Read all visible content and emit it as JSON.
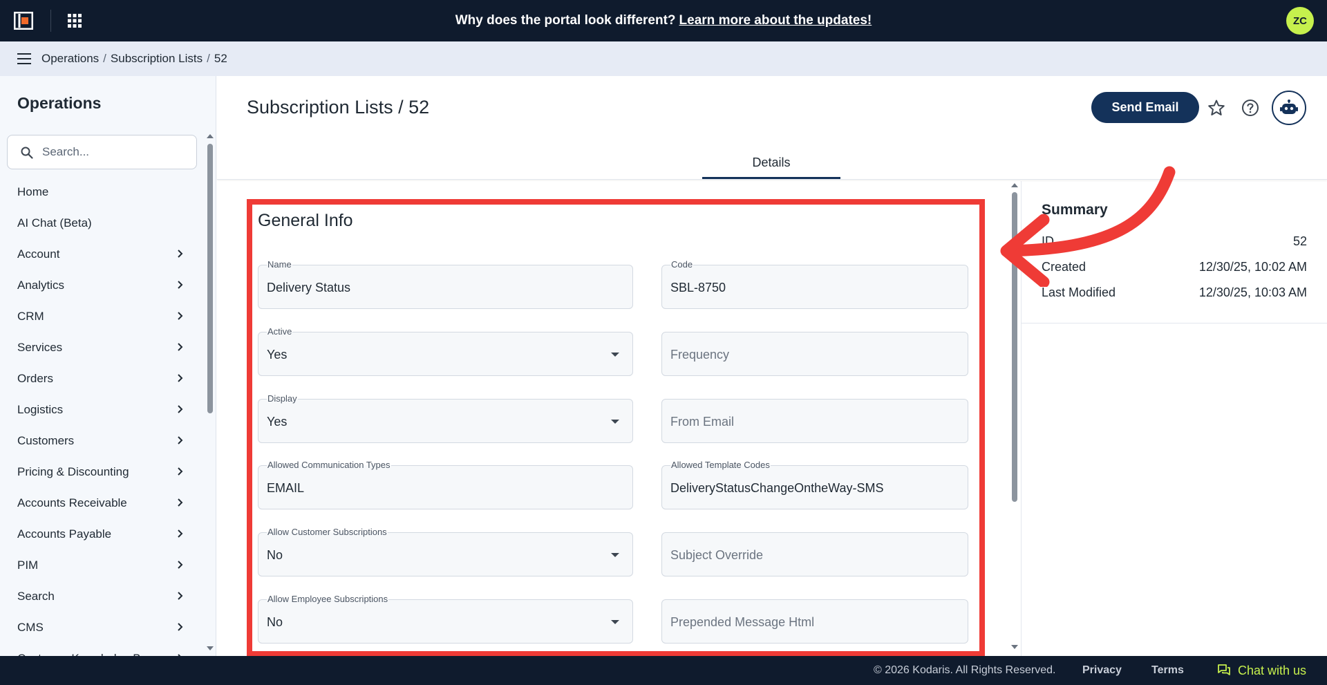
{
  "banner": {
    "question": "Why does the portal look different?",
    "link": "Learn more about the updates!"
  },
  "user": {
    "initials": "ZC"
  },
  "breadcrumb": {
    "items": [
      "Operations",
      "Subscription Lists",
      "52"
    ]
  },
  "sidebar": {
    "title": "Operations",
    "search_placeholder": "Search...",
    "items": [
      {
        "label": "Home",
        "has_children": false
      },
      {
        "label": "AI Chat (Beta)",
        "has_children": false
      },
      {
        "label": "Account",
        "has_children": true
      },
      {
        "label": "Analytics",
        "has_children": true
      },
      {
        "label": "CRM",
        "has_children": true
      },
      {
        "label": "Services",
        "has_children": true
      },
      {
        "label": "Orders",
        "has_children": true
      },
      {
        "label": "Logistics",
        "has_children": true
      },
      {
        "label": "Customers",
        "has_children": true
      },
      {
        "label": "Pricing & Discounting",
        "has_children": true
      },
      {
        "label": "Accounts Receivable",
        "has_children": true
      },
      {
        "label": "Accounts Payable",
        "has_children": true
      },
      {
        "label": "PIM",
        "has_children": true
      },
      {
        "label": "Search",
        "has_children": true
      },
      {
        "label": "CMS",
        "has_children": true
      },
      {
        "label": "Customer Knowledge B",
        "has_children": true
      }
    ]
  },
  "header": {
    "title": "Subscription Lists / 52",
    "send_email_label": "Send Email"
  },
  "tabs": [
    {
      "label": "Details",
      "active": true
    }
  ],
  "general_info": {
    "title": "General Info",
    "left_fields": [
      {
        "label": "Name",
        "value": "Delivery Status",
        "type": "text"
      },
      {
        "label": "Active",
        "value": "Yes",
        "type": "select"
      },
      {
        "label": "Display",
        "value": "Yes",
        "type": "select"
      },
      {
        "label": "Allowed Communication Types",
        "value": "EMAIL",
        "type": "text"
      },
      {
        "label": "Allow Customer Subscriptions",
        "value": "No",
        "type": "select"
      },
      {
        "label": "Allow Employee Subscriptions",
        "value": "No",
        "type": "select"
      }
    ],
    "right_fields": [
      {
        "label": "Code",
        "value": "SBL-8750",
        "type": "text"
      },
      {
        "label": "",
        "placeholder": "Frequency",
        "type": "text"
      },
      {
        "label": "",
        "placeholder": "From Email",
        "type": "text"
      },
      {
        "label": "Allowed Template Codes",
        "value": "DeliveryStatusChangeOntheWay-SMS",
        "type": "text"
      },
      {
        "label": "",
        "placeholder": "Subject Override",
        "type": "text"
      },
      {
        "label": "",
        "placeholder": "Prepended Message Html",
        "type": "text"
      }
    ]
  },
  "summary": {
    "title": "Summary",
    "rows": [
      {
        "label": "ID",
        "value": "52"
      },
      {
        "label": "Created",
        "value": "12/30/25, 10:02 AM"
      },
      {
        "label": "Last Modified",
        "value": "12/30/25, 10:03 AM"
      }
    ]
  },
  "footer": {
    "copyright": "© 2026 Kodaris. All Rights Reserved.",
    "privacy": "Privacy",
    "terms": "Terms",
    "chat": "Chat with us"
  },
  "colors": {
    "topbar": "#0f1b2d",
    "accent": "#14325a",
    "avatar": "#c6f04d",
    "annotation": "#ef3b36"
  },
  "icons": [
    "logo-icon",
    "apps-grid-icon",
    "menu-icon",
    "search-icon",
    "chevron-right-icon",
    "star-icon",
    "help-icon",
    "robot-icon",
    "dropdown-caret-icon",
    "chat-icon"
  ]
}
